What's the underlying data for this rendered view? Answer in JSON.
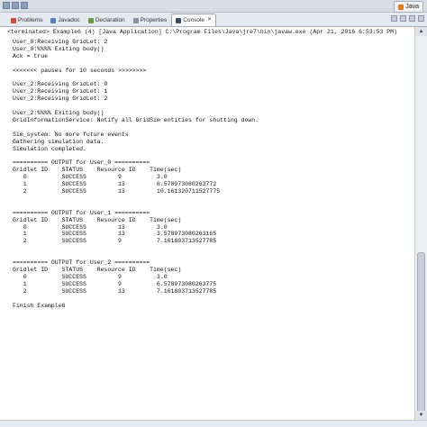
{
  "window": {
    "perspective_label": "Java"
  },
  "tabs": [
    {
      "label": "Problems"
    },
    {
      "label": "Javadoc"
    },
    {
      "label": "Declaration"
    },
    {
      "label": "Properties"
    },
    {
      "label": "Console"
    }
  ],
  "console": {
    "header": "<terminated> Example6 (4) [Java Application] C:\\Program Files\\Java\\jre7\\bin\\javaw.exe (Apr 21, 2016 6:53:53 PM)",
    "lines": [
      "User_0:Receiving GridLet: 2",
      "User_0:%%%% Exiting body()",
      "Ack = true",
      "",
      "<<<<<<< pauses for 10 seconds >>>>>>>>",
      "",
      "User_2:Receiving GridLet: 0",
      "User_2:Receiving GridLet: 1",
      "User_2:Receiving GridLet: 2",
      "",
      "User_2:%%%% Exiting body()",
      "GridInformationService: Notify all GridSim entities for shutting down.",
      "",
      "Sim_system: No more future events",
      "Gathering simulation data.",
      "Simulation completed.",
      "",
      "========== OUTPUT for User_0 ==========",
      "Gridlet ID    STATUS    Resource ID    Time(sec)",
      "   0          SUCCESS         9          3.0",
      "   1          SUCCESS         13         6.578973080263772",
      "   2          SUCCESS         13         10.161320711527775",
      "",
      "",
      "========== OUTPUT for User_1 ==========",
      "Gridlet ID    STATUS    Resource ID    Time(sec)",
      "   0          SUCCESS         13         3.0",
      "   1          SUCCESS         13         3.578973080263165",
      "   2          SUCCESS         9          7.161803713527785",
      "",
      "",
      "========== OUTPUT for User_2 ==========",
      "Gridlet ID    STATUS    Resource ID    Time(sec)",
      "   0          SUCCESS         9          3.0",
      "   1          SUCCESS         9          6.578973080263775",
      "   2          SUCCESS         13         7.161803713527785",
      "",
      "Finish Example6"
    ]
  }
}
